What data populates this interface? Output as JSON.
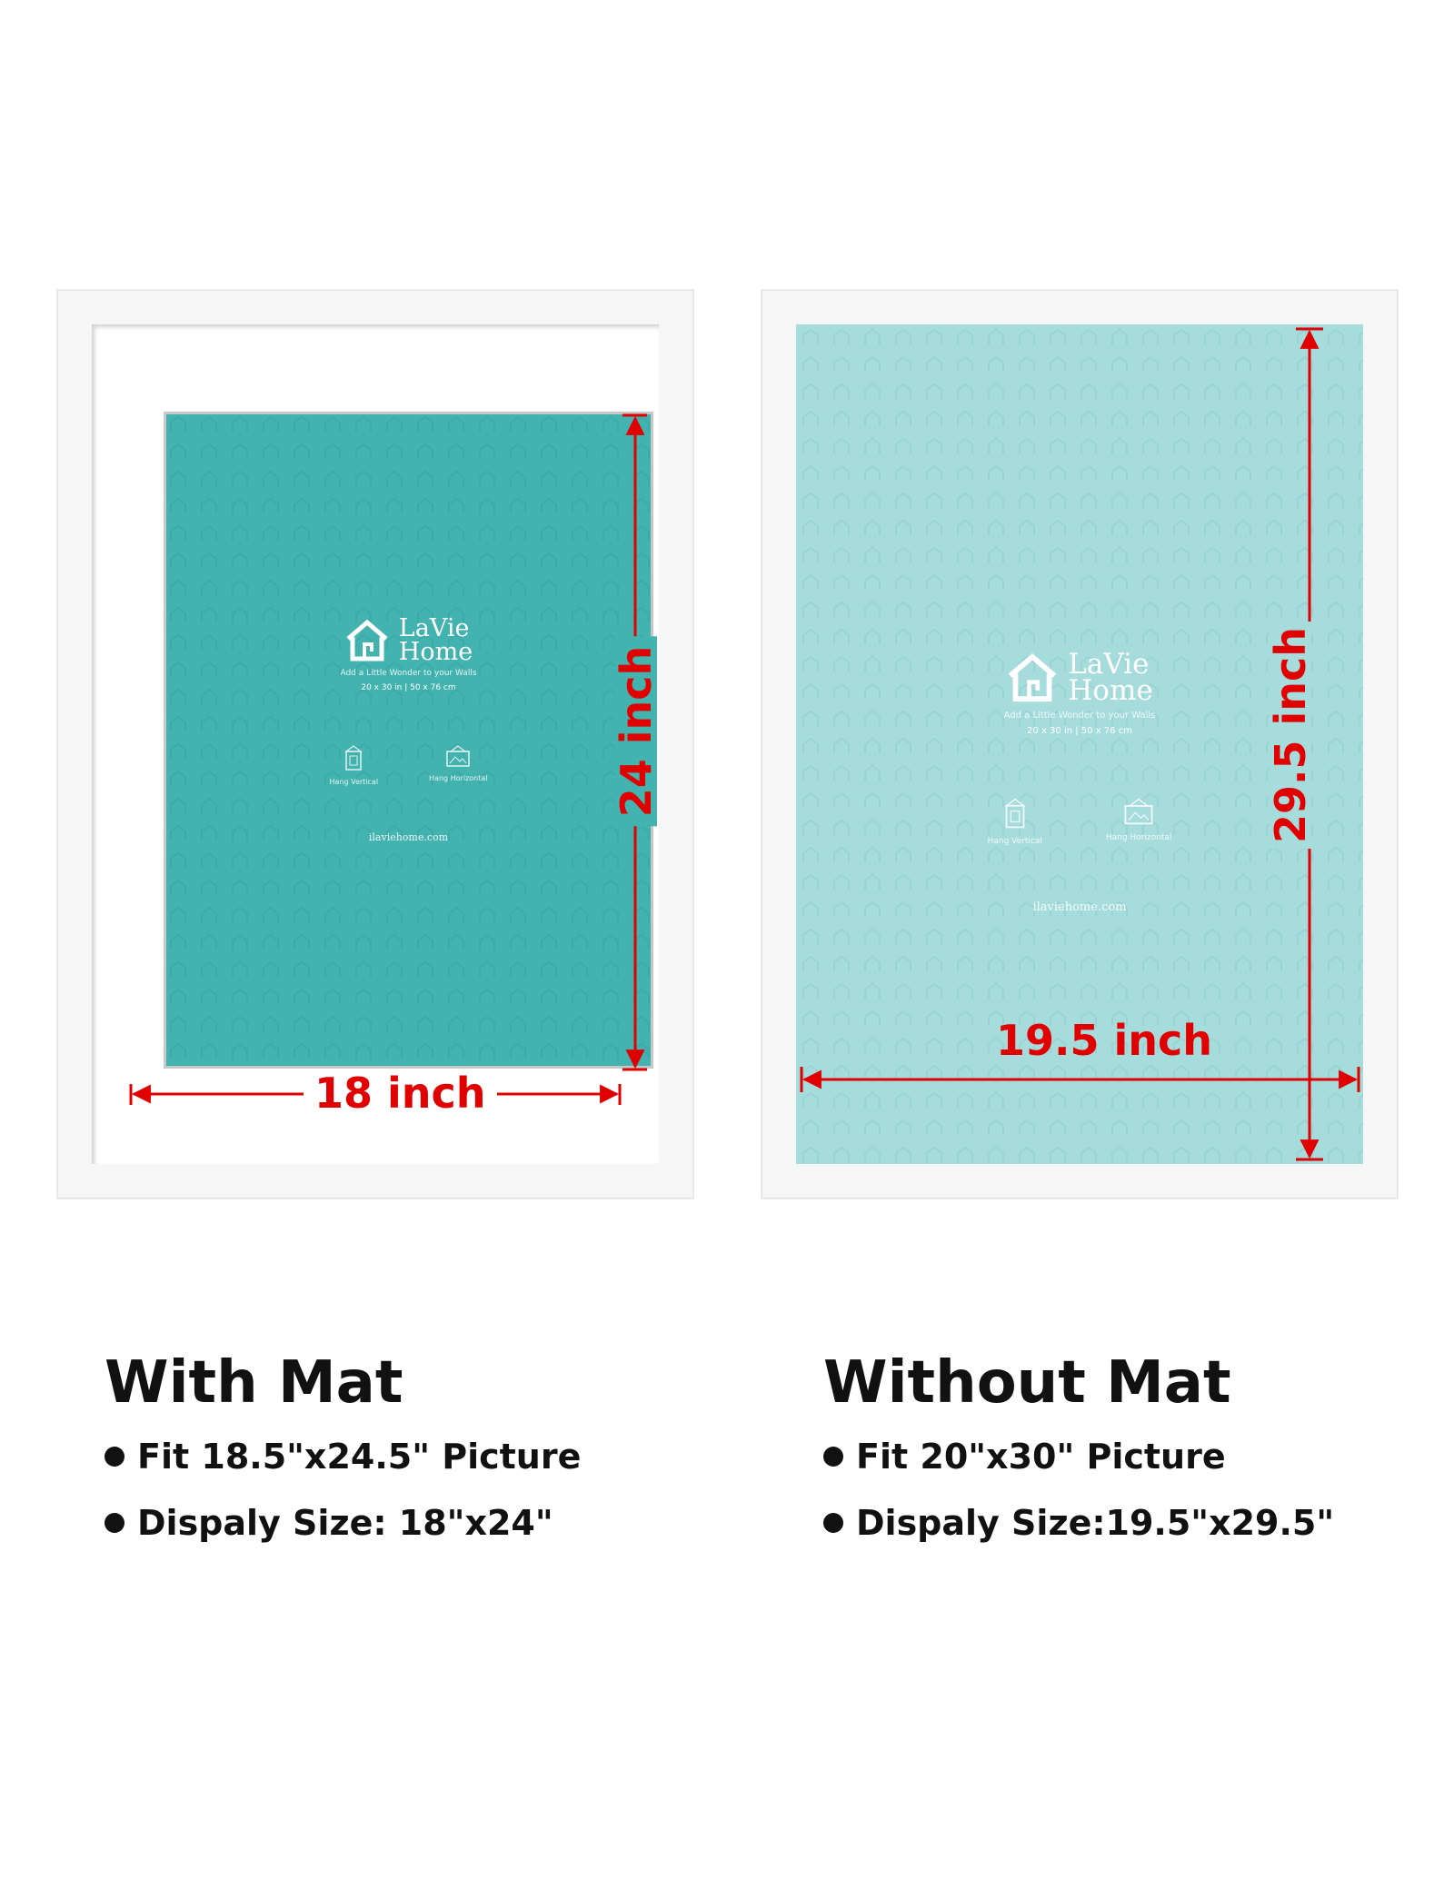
{
  "colors": {
    "teal_poster": "#43b3b0",
    "light_teal_poster": "#a6dcdc",
    "frame_white": "#f6f6f6",
    "dimension_red": "#e00000",
    "text": "#111111"
  },
  "poster": {
    "brand_line1": "LaVie",
    "brand_line2": "Home",
    "tagline": "Add a Little Wonder to your Walls",
    "size": "20 x 30 in | 50 x 76 cm",
    "hang_vertical": "Hang Vertical",
    "hang_horizontal": "Hang Horizontal",
    "website": "ilaviehome.com",
    "icons": [
      "house-logo-icon",
      "hang-vertical-icon",
      "hang-horizontal-icon"
    ]
  },
  "with_mat": {
    "title": "With Mat",
    "width_label": "18 inch",
    "height_label": "24 inch",
    "bullets": [
      "Fit 18.5\"x24.5\" Picture",
      "Dispaly Size: 18\"x24\""
    ]
  },
  "without_mat": {
    "title": "Without Mat",
    "width_label": "19.5 inch",
    "height_label": "29.5 inch",
    "bullets": [
      "Fit 20\"x30\" Picture",
      "Dispaly Size:19.5\"x29.5\""
    ]
  }
}
